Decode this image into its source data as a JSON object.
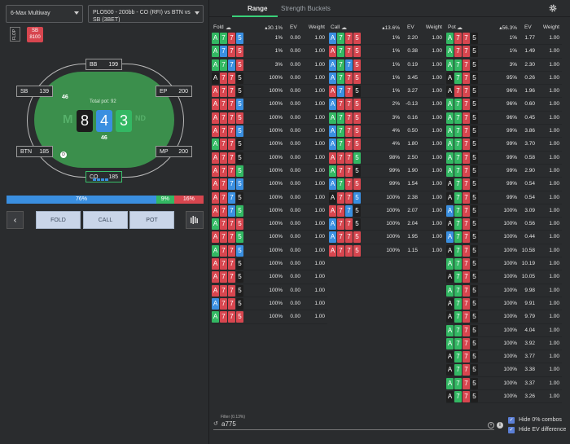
{
  "header": {
    "game_select": "6-Max Multiway",
    "spot_select": "PLO500 - 200bb - CO (RFI) vs BTN vs SB (3BET)"
  },
  "street_tag": "FLOP",
  "sb_tag": {
    "label": "SB",
    "amount": "8100"
  },
  "table": {
    "pot_label": "Total pot: 92",
    "board": [
      {
        "rank": "8",
        "suit": "s"
      },
      {
        "rank": "4",
        "suit": "d"
      },
      {
        "rank": "3",
        "suit": "c"
      }
    ],
    "effective": "46",
    "logo_left": "M",
    "logo_right": "ND",
    "dealer": "D",
    "bets": {
      "sb": "46",
      "btn": "46"
    },
    "seats": [
      {
        "name": "BB",
        "stack": "199"
      },
      {
        "name": "SB",
        "stack": "139"
      },
      {
        "name": "EP",
        "stack": "200"
      },
      {
        "name": "BTN",
        "stack": "185"
      },
      {
        "name": "MP",
        "stack": "200"
      },
      {
        "name": "CO",
        "stack": "185"
      }
    ]
  },
  "frequency_bar": {
    "fold": "76%",
    "call": "9%",
    "pot": "16%"
  },
  "actions": {
    "back": "‹",
    "fold": "FOLD",
    "call": "CALL",
    "pot": "POT"
  },
  "tabs": {
    "range": "Range",
    "buckets": "Strength Buckets"
  },
  "columns": {
    "fold": {
      "name": "Fold",
      "pct": "30.1%",
      "ev": "EV",
      "weight": "Weight"
    },
    "call": {
      "name": "Call",
      "pct": "13.6%",
      "ev": "EV",
      "weight": "Weight"
    },
    "pot": {
      "name": "Pot",
      "pct": "56.3%",
      "ev": "EV",
      "weight": "Weight"
    }
  },
  "fold_rows": [
    {
      "cards": "cchd",
      "pct": "1%",
      "ev": "0.00",
      "w": "1.00"
    },
    {
      "cards": "cdhh",
      "pct": "1%",
      "ev": "0.00",
      "w": "1.00"
    },
    {
      "cards": "ccdh",
      "pct": "3%",
      "ev": "0.00",
      "w": "1.00"
    },
    {
      "cards": "shhs",
      "pct": "100%",
      "ev": "0.00",
      "w": "1.00"
    },
    {
      "cards": "hhhs",
      "pct": "100%",
      "ev": "0.00",
      "w": "1.00"
    },
    {
      "cards": "hhhd",
      "pct": "100%",
      "ev": "0.00",
      "w": "1.00"
    },
    {
      "cards": "hhhh",
      "pct": "100%",
      "ev": "0.00",
      "w": "1.00"
    },
    {
      "cards": "hhhd",
      "pct": "100%",
      "ev": "0.00",
      "w": "1.00"
    },
    {
      "cards": "chhs",
      "pct": "100%",
      "ev": "0.00",
      "w": "1.00"
    },
    {
      "cards": "hhhs",
      "pct": "100%",
      "ev": "0.00",
      "w": "1.00"
    },
    {
      "cards": "hhhc",
      "pct": "100%",
      "ev": "0.00",
      "w": "1.00"
    },
    {
      "cards": "hhdd",
      "pct": "100%",
      "ev": "0.00",
      "w": "1.00"
    },
    {
      "cards": "hhds",
      "pct": "100%",
      "ev": "0.00",
      "w": "1.00"
    },
    {
      "cards": "hhdc",
      "pct": "100%",
      "ev": "0.00",
      "w": "1.00"
    },
    {
      "cards": "chhh",
      "pct": "100%",
      "ev": "0.00",
      "w": "1.00"
    },
    {
      "cards": "hhhc",
      "pct": "100%",
      "ev": "0.00",
      "w": "1.00"
    },
    {
      "cards": "chhd",
      "pct": "100%",
      "ev": "0.00",
      "w": "1.00"
    },
    {
      "cards": "hhhs",
      "pct": "100%",
      "ev": "0.00",
      "w": "1.00"
    },
    {
      "cards": "hhhs",
      "pct": "100%",
      "ev": "0.00",
      "w": "1.00"
    },
    {
      "cards": "hhhs",
      "pct": "100%",
      "ev": "0.00",
      "w": "1.00"
    },
    {
      "cards": "dhhs",
      "pct": "100%",
      "ev": "0.00",
      "w": "1.00"
    },
    {
      "cards": "chhh",
      "pct": "100%",
      "ev": "0.00",
      "w": "1.00"
    }
  ],
  "call_rows": [
    {
      "cards": "dchh",
      "pct": "1%",
      "ev": "2.20",
      "w": "1.00"
    },
    {
      "cards": "hchh",
      "pct": "1%",
      "ev": "0.38",
      "w": "1.00"
    },
    {
      "cards": "dcdh",
      "pct": "1%",
      "ev": "0.19",
      "w": "1.00"
    },
    {
      "cards": "dchh",
      "pct": "1%",
      "ev": "3.45",
      "w": "1.00"
    },
    {
      "cards": "hdhs",
      "pct": "1%",
      "ev": "3.27",
      "w": "1.00"
    },
    {
      "cards": "dhhh",
      "pct": "2%",
      "ev": "-0.13",
      "w": "1.00"
    },
    {
      "cards": "cchh",
      "pct": "3%",
      "ev": "0.16",
      "w": "1.00"
    },
    {
      "cards": "dchh",
      "pct": "4%",
      "ev": "0.50",
      "w": "1.00"
    },
    {
      "cards": "dchh",
      "pct": "4%",
      "ev": "1.80",
      "w": "1.00"
    },
    {
      "cards": "hhhc",
      "pct": "98%",
      "ev": "2.50",
      "w": "1.00"
    },
    {
      "cards": "chhs",
      "pct": "99%",
      "ev": "1.90",
      "w": "1.00"
    },
    {
      "cards": "dchh",
      "pct": "99%",
      "ev": "1.54",
      "w": "1.00"
    },
    {
      "cards": "shhd",
      "pct": "100%",
      "ev": "2.38",
      "w": "1.00"
    },
    {
      "cards": "hhds",
      "pct": "100%",
      "ev": "2.07",
      "w": "1.00"
    },
    {
      "cards": "dhhs",
      "pct": "100%",
      "ev": "2.04",
      "w": "1.00"
    },
    {
      "cards": "dhhh",
      "pct": "100%",
      "ev": "1.95",
      "w": "1.00"
    },
    {
      "cards": "hhhh",
      "pct": "100%",
      "ev": "1.15",
      "w": "1.00"
    }
  ],
  "pot_rows": [
    {
      "cards": "chhs",
      "pct": "1%",
      "ev": "1.77",
      "w": "1.00"
    },
    {
      "cards": "chhs",
      "pct": "1%",
      "ev": "1.49",
      "w": "1.00"
    },
    {
      "cards": "cchs",
      "pct": "3%",
      "ev": "2.30",
      "w": "1.00"
    },
    {
      "cards": "schs",
      "pct": "95%",
      "ev": "0.26",
      "w": "1.00"
    },
    {
      "cards": "shhs",
      "pct": "96%",
      "ev": "1.96",
      "w": "1.00"
    },
    {
      "cards": "cchs",
      "pct": "96%",
      "ev": "0.60",
      "w": "1.00"
    },
    {
      "cards": "cchs",
      "pct": "96%",
      "ev": "0.45",
      "w": "1.00"
    },
    {
      "cards": "cchs",
      "pct": "99%",
      "ev": "3.86",
      "w": "1.00"
    },
    {
      "cards": "cchs",
      "pct": "99%",
      "ev": "3.70",
      "w": "1.00"
    },
    {
      "cards": "cchs",
      "pct": "99%",
      "ev": "0.58",
      "w": "1.00"
    },
    {
      "cards": "cchs",
      "pct": "99%",
      "ev": "2.90",
      "w": "1.00"
    },
    {
      "cards": "schs",
      "pct": "99%",
      "ev": "0.54",
      "w": "1.00"
    },
    {
      "cards": "schs",
      "pct": "99%",
      "ev": "0.54",
      "w": "1.00"
    },
    {
      "cards": "dchs",
      "pct": "100%",
      "ev": "3.09",
      "w": "1.00"
    },
    {
      "cards": "schs",
      "pct": "100%",
      "ev": "0.56",
      "w": "1.00"
    },
    {
      "cards": "dchs",
      "pct": "100%",
      "ev": "0.44",
      "w": "1.00"
    },
    {
      "cards": "schs",
      "pct": "100%",
      "ev": "10.58",
      "w": "1.00"
    },
    {
      "cards": "cchs",
      "pct": "100%",
      "ev": "10.19",
      "w": "1.00"
    },
    {
      "cards": "schs",
      "pct": "100%",
      "ev": "10.05",
      "w": "1.00"
    },
    {
      "cards": "cchs",
      "pct": "100%",
      "ev": "9.98",
      "w": "1.00"
    },
    {
      "cards": "schs",
      "pct": "100%",
      "ev": "9.91",
      "w": "1.00"
    },
    {
      "cards": "schs",
      "pct": "100%",
      "ev": "9.79",
      "w": "1.00"
    },
    {
      "cards": "cchs",
      "pct": "100%",
      "ev": "4.04",
      "w": "1.00"
    },
    {
      "cards": "cchs",
      "pct": "100%",
      "ev": "3.92",
      "w": "1.00"
    },
    {
      "cards": "schs",
      "pct": "100%",
      "ev": "3.77",
      "w": "1.00"
    },
    {
      "cards": "schs",
      "pct": "100%",
      "ev": "3.38",
      "w": "1.00"
    },
    {
      "cards": "cchs",
      "pct": "100%",
      "ev": "3.37",
      "w": "1.00"
    },
    {
      "cards": "schs",
      "pct": "100%",
      "ev": "3.26",
      "w": "1.00"
    }
  ],
  "hand_ranks": [
    "A",
    "7",
    "7",
    "5"
  ],
  "filter": {
    "label": "Filter (0.13%)",
    "value": "a775"
  },
  "options": {
    "hide_zero": "Hide 0% combos",
    "hide_ev": "Hide EV difference"
  },
  "colors": {
    "spade": "#1f1f1f",
    "heart": "#d7464f",
    "diamond": "#3a8fe0",
    "club": "#33b863",
    "accent": "#3ad17a"
  }
}
